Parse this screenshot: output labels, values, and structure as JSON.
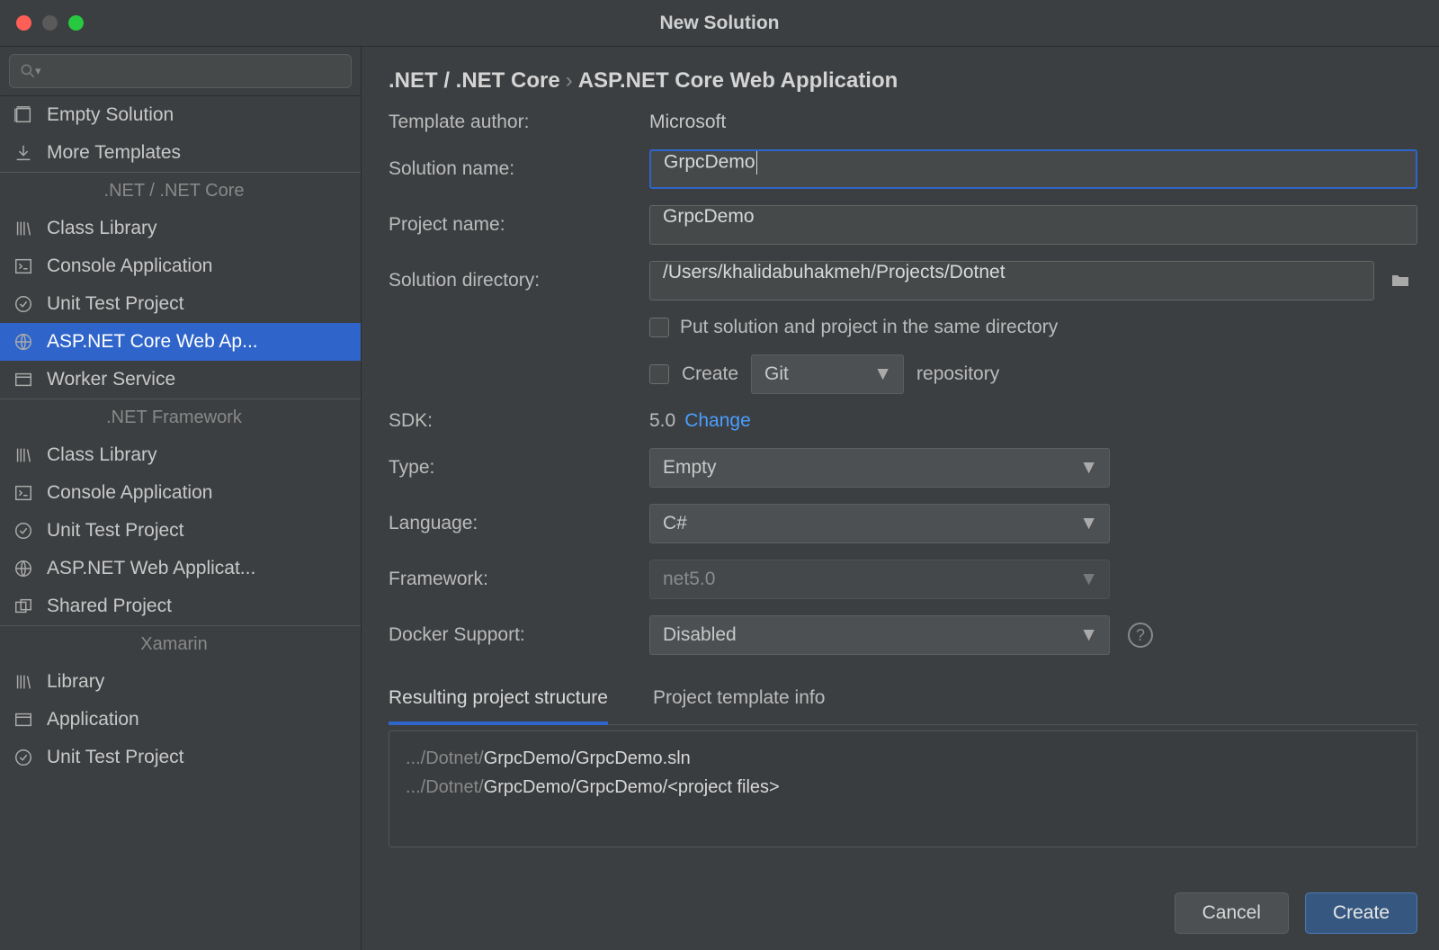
{
  "titlebar": {
    "title": "New Solution"
  },
  "sidebar": {
    "items": [
      {
        "label": "Empty Solution",
        "icon": "empty-solution-icon"
      },
      {
        "label": "More Templates",
        "icon": "download-icon"
      },
      {
        "label": ".NET / .NET Core",
        "cat": true,
        "sep": true
      },
      {
        "label": "Class Library",
        "icon": "library-icon"
      },
      {
        "label": "Console Application",
        "icon": "console-icon"
      },
      {
        "label": "Unit Test Project",
        "icon": "test-icon"
      },
      {
        "label": "ASP.NET Core Web Ap...",
        "icon": "globe-icon",
        "selected": true
      },
      {
        "label": "Worker Service",
        "icon": "window-icon"
      },
      {
        "label": ".NET Framework",
        "cat": true,
        "sep": true
      },
      {
        "label": "Class Library",
        "icon": "library-icon"
      },
      {
        "label": "Console Application",
        "icon": "console-icon"
      },
      {
        "label": "Unit Test Project",
        "icon": "test-icon"
      },
      {
        "label": "ASP.NET Web Applicat...",
        "icon": "globe-icon"
      },
      {
        "label": "Shared Project",
        "icon": "shared-icon"
      },
      {
        "label": "Xamarin",
        "cat": true,
        "sep": true
      },
      {
        "label": "Library",
        "icon": "library-icon"
      },
      {
        "label": "Application",
        "icon": "window-icon"
      },
      {
        "label": "Unit Test Project",
        "icon": "test-icon"
      }
    ]
  },
  "main": {
    "breadcrumb": {
      "group": ".NET / .NET Core",
      "template": "ASP.NET Core Web Application"
    },
    "labels": {
      "author": "Template author:",
      "solution_name": "Solution name:",
      "project_name": "Project name:",
      "solution_dir": "Solution directory:",
      "put_same": "Put solution and project in the same directory",
      "create": "Create",
      "repository": "repository",
      "sdk": "SDK:",
      "type": "Type:",
      "language": "Language:",
      "framework": "Framework:",
      "docker": "Docker Support:"
    },
    "values": {
      "author": "Microsoft",
      "solution_name": "GrpcDemo",
      "project_name": "GrpcDemo",
      "solution_dir": "/Users/khalidabuhakmeh/Projects/Dotnet",
      "git": "Git",
      "sdk": "5.0",
      "sdk_change": "Change",
      "type": "Empty",
      "language": "C#",
      "framework": "net5.0",
      "docker": "Disabled"
    },
    "tabs": {
      "structure": "Resulting project structure",
      "info": "Project template info"
    },
    "result": {
      "line1_dim": ".../Dotnet/",
      "line1_strong": "GrpcDemo/GrpcDemo.sln",
      "line2_dim": ".../Dotnet/",
      "line2_strong": "GrpcDemo/GrpcDemo/<project files>"
    },
    "buttons": {
      "cancel": "Cancel",
      "create": "Create"
    }
  }
}
